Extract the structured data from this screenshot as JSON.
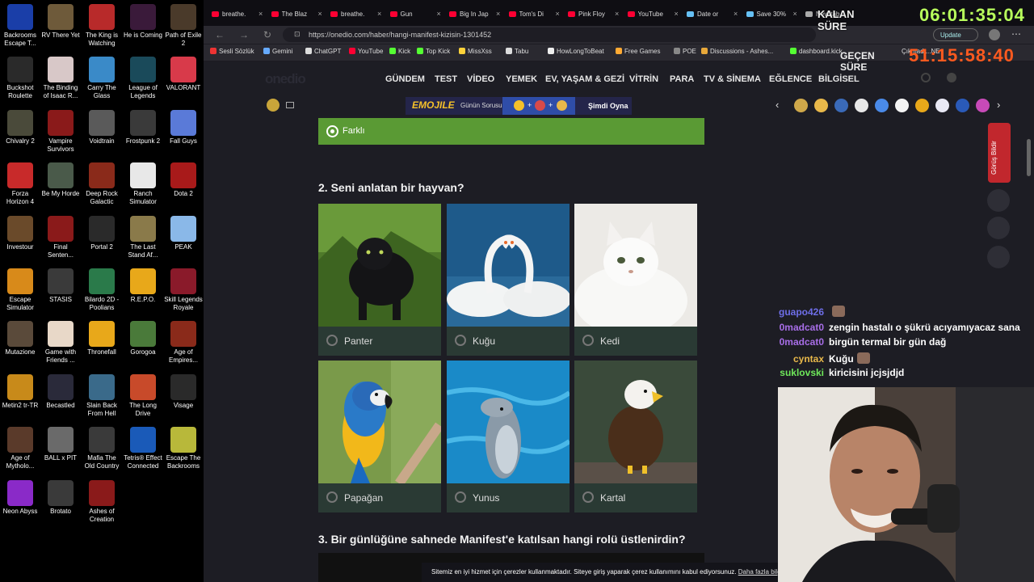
{
  "desktop": {
    "icons": [
      {
        "label": "Backrooms\nEscape T...",
        "color": "#1a3ea8"
      },
      {
        "label": "RV There Yet",
        "color": "#6e5a3a"
      },
      {
        "label": "The King is\nWatching",
        "color": "#b82a2a"
      },
      {
        "label": "He is Coming",
        "color": "#3a1a3a"
      },
      {
        "label": "Path of Exile\n2",
        "color": "#4a3a2a"
      },
      {
        "label": "Buckshot\nRoulette",
        "color": "#2a2a2a"
      },
      {
        "label": "The Binding\nof Isaac R...",
        "color": "#d8c8c8"
      },
      {
        "label": "Carry The\nGlass",
        "color": "#3a8ac8"
      },
      {
        "label": "League of\nLegends",
        "color": "#1a4a5a"
      },
      {
        "label": "VALORANT",
        "color": "#d83a4a"
      },
      {
        "label": "Chivalry 2",
        "color": "#4a4a3a"
      },
      {
        "label": "Vampire\nSurvivors",
        "color": "#8a1a1a"
      },
      {
        "label": "Voidtrain",
        "color": "#5a5a5a"
      },
      {
        "label": "Frostpunk 2",
        "color": "#3a3a3a"
      },
      {
        "label": "Fall Guys",
        "color": "#5a7ad8"
      },
      {
        "label": "Forza\nHorizon 4",
        "color": "#c82a2a"
      },
      {
        "label": "Be My Horde",
        "color": "#4a5a4a"
      },
      {
        "label": "Deep Rock\nGalactic",
        "color": "#8a2a1a"
      },
      {
        "label": "Ranch\nSimulator",
        "color": "#e8e8e8"
      },
      {
        "label": "Dota 2",
        "color": "#a81a1a"
      },
      {
        "label": "Investour",
        "color": "#6a4a2a"
      },
      {
        "label": "Final\nSenten...",
        "color": "#8a1a1a"
      },
      {
        "label": "Portal 2",
        "color": "#2a2a2a"
      },
      {
        "label": "The Last\nStand Af...",
        "color": "#8a7a4a"
      },
      {
        "label": "PEAK",
        "color": "#8ab8e8"
      },
      {
        "label": "Escape\nSimulator",
        "color": "#d88a1a"
      },
      {
        "label": "STASIS",
        "color": "#3a3a3a"
      },
      {
        "label": "Bilardo 2D -\nPoolians",
        "color": "#2a7a4a"
      },
      {
        "label": "R.E.P.O.",
        "color": "#e8a81a"
      },
      {
        "label": "Skill Legends\nRoyale",
        "color": "#8a1a2a"
      },
      {
        "label": "Mutazione",
        "color": "#5a4a3a"
      },
      {
        "label": "Game with\nFriends ...",
        "color": "#e8d8c8"
      },
      {
        "label": "Thronefall",
        "color": "#e8a81a"
      },
      {
        "label": "Gorogoa",
        "color": "#4a7a3a"
      },
      {
        "label": "Age of\nEmpires...",
        "color": "#8a2a1a"
      },
      {
        "label": "Metin2 tr-TR",
        "color": "#c88a1a"
      },
      {
        "label": "Becastled",
        "color": "#2a2a3a"
      },
      {
        "label": "Slain Back\nFrom Hell",
        "color": "#3a6a8a"
      },
      {
        "label": "The Long\nDrive",
        "color": "#c84a2a"
      },
      {
        "label": "Visage",
        "color": "#2a2a2a"
      },
      {
        "label": "Age of\nMytholo...",
        "color": "#5a3a2a"
      },
      {
        "label": "BALL x PIT",
        "color": "#6a6a6a"
      },
      {
        "label": "Mafia The\nOld Country",
        "color": "#3a3a3a"
      },
      {
        "label": "Tetris® Effect\nConnected",
        "color": "#1a5ab8"
      },
      {
        "label": "Escape The\nBackrooms",
        "color": "#b8b83a"
      },
      {
        "label": "Neon Abyss",
        "color": "#8a2ac8"
      },
      {
        "label": "Brotato",
        "color": "#3a3a3a"
      },
      {
        "label": "Ashes of\nCreation",
        "color": "#8a1a1a"
      }
    ]
  },
  "browser": {
    "tabs": [
      {
        "title": "breathe.",
        "icon": "youtube-icon",
        "color": "#ff0033"
      },
      {
        "title": "The Blaz",
        "icon": "youtube-icon",
        "color": "#ff0033"
      },
      {
        "title": "breathe.",
        "icon": "youtube-icon",
        "color": "#ff0033"
      },
      {
        "title": "Gun",
        "icon": "youtube-icon",
        "color": "#ff0033"
      },
      {
        "title": "Big In Jap",
        "icon": "youtube-icon",
        "color": "#ff0033"
      },
      {
        "title": "Tom's Di",
        "icon": "youtube-icon",
        "color": "#ff0033"
      },
      {
        "title": "Pink Floy",
        "icon": "youtube-icon",
        "color": "#ff0033"
      },
      {
        "title": "YouTube",
        "icon": "youtube-icon",
        "color": "#ff0033"
      },
      {
        "title": "Date or",
        "icon": "steam-icon",
        "color": "#66c0f4"
      },
      {
        "title": "Save 30%",
        "icon": "steam-icon",
        "color": "#66c0f4"
      },
      {
        "title": "New tab",
        "icon": "page-icon",
        "color": "#aaaaaa"
      }
    ],
    "url": "https://onedio.com/haber/hangi-manifest-kizisin-1301452",
    "update_label": "Update",
    "bookmarks": [
      {
        "label": "Sesli Sözlük",
        "color": "#e33"
      },
      {
        "label": "Gemini",
        "color": "#6af"
      },
      {
        "label": "ChatGPT",
        "color": "#ddd"
      },
      {
        "label": "YouTube",
        "color": "#f03"
      },
      {
        "label": "Kick",
        "color": "#5f3"
      },
      {
        "label": "Top Kick",
        "color": "#5f3"
      },
      {
        "label": "MissXss",
        "color": "#ffd23a"
      },
      {
        "label": "Tabu",
        "color": "#ddd"
      },
      {
        "label": "HowLongToBeat",
        "color": "#eee"
      },
      {
        "label": "Free Games",
        "color": "#fa3"
      },
      {
        "label": "POE",
        "color": "#888"
      },
      {
        "label": "Discussions - Ashes...",
        "color": "#e8a83a"
      },
      {
        "label": "dashboard.kick",
        "color": "#5f3"
      }
    ],
    "bookmark_trailing": "Çıkmadı...",
    "bookmark_trailing_suffix": "NE"
  },
  "overlay": {
    "remaining_label": "KALAN SÜRE",
    "remaining_time": "06:01:35:04",
    "elapsed_label": "GEÇEN SÜRE",
    "elapsed_time": "51:15:58:40",
    "remaining_color": "#b8ff5c",
    "elapsed_color": "#ff5a1f"
  },
  "site": {
    "logo": "onedio",
    "nav": [
      "GÜNDEM",
      "TEST",
      "VİDEO",
      "YEMEK",
      "EV, YAŞAM & GEZİ",
      "VİTRİN",
      "PARA",
      "TV & SİNEMA",
      "EĞLENCE",
      "BİLGİSEL"
    ],
    "emojile": "EMOJILE",
    "gunun_sorusu": "Günün Sorusu",
    "simdi_oyna": "Şimdi Oyna",
    "selected_answer": "Farklı",
    "question2": "2. Seni anlatan bir hayvan?",
    "options": [
      "Panter",
      "Kuğu",
      "Kedi",
      "Papağan",
      "Yunus",
      "Kartal"
    ],
    "question3": "3. Bir günlüğüne sahnede Manifest'e katılsan hangi rolü üstlenirdin?",
    "feedback_label": "Görüş Bildir",
    "cookie_text": "Sitemiz en iyi hizmet için çerezler kullanmaktadır. Siteye giriş yaparak çerez kullanımını kabul ediyorsunuz.",
    "cookie_link": "Daha fazla bilgi",
    "accent": "#5a9a34"
  },
  "chat": {
    "messages": [
      {
        "user": "guapo426",
        "text": "",
        "color": "#6e6ee8"
      },
      {
        "user": "0madcat0",
        "text": "zengin hastalı o şükrü acıyamıyacaz sana",
        "color": "#a86ee8"
      },
      {
        "user": "0madcat0",
        "text": "birgün termal bir gün dağ",
        "color": "#a86ee8"
      },
      {
        "user": "cyntax",
        "text": "Kuğu",
        "color": "#e8b84a"
      },
      {
        "user": "suklovski",
        "text": "kiricisini jcjsjdjd",
        "color": "#6ee85a"
      }
    ]
  }
}
